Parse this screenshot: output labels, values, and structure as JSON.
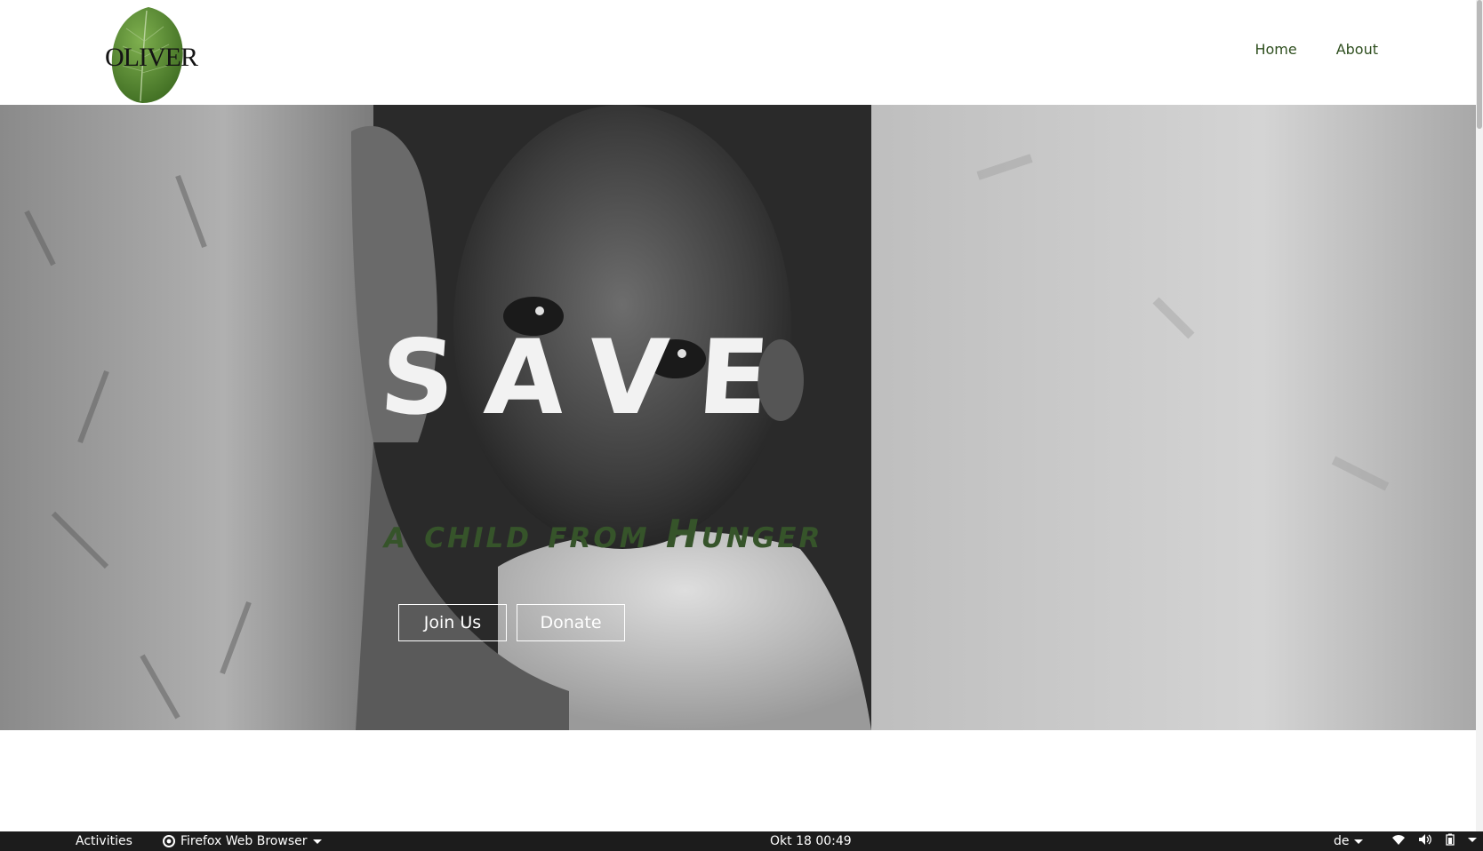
{
  "brand": {
    "logo_text": "OLIVER",
    "leaf_color": "#5f8f3a"
  },
  "nav": {
    "items": [
      {
        "label": "Home"
      },
      {
        "label": "About"
      }
    ],
    "link_color": "#2f4f1f"
  },
  "hero": {
    "title": "SAVE",
    "subtitle": "a child from Hunger",
    "subtitle_color": "#36542a",
    "buttons": [
      {
        "label": "Join Us"
      },
      {
        "label": "Donate"
      }
    ]
  },
  "taskbar": {
    "activities": "Activities",
    "app_label": "Firefox Web Browser",
    "clock": "Okt 18  00:49",
    "keyboard_layout": "de",
    "tray_icons": [
      "wifi-icon",
      "volume-icon",
      "battery-icon",
      "system-menu-icon"
    ]
  }
}
